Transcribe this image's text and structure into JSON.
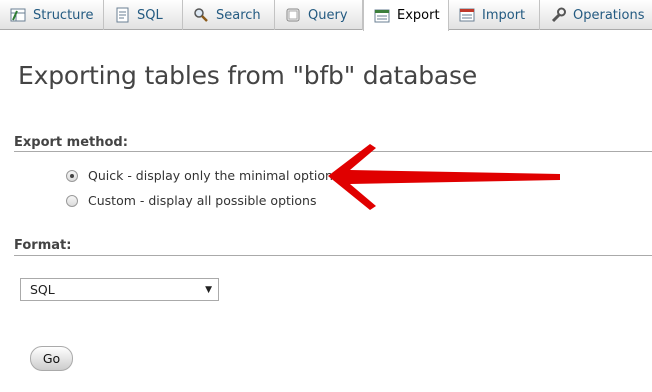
{
  "tabs": [
    {
      "label": "Structure",
      "icon": "structure-icon"
    },
    {
      "label": "SQL",
      "icon": "sql-icon"
    },
    {
      "label": "Search",
      "icon": "search-icon"
    },
    {
      "label": "Query",
      "icon": "query-icon"
    },
    {
      "label": "Export",
      "icon": "export-icon",
      "active": true
    },
    {
      "label": "Import",
      "icon": "import-icon"
    },
    {
      "label": "Operations",
      "icon": "operations-icon"
    }
  ],
  "page": {
    "title": "Exporting tables from \"bfb\" database"
  },
  "export_method": {
    "heading": "Export method:",
    "options": [
      {
        "label": "Quick - display only the minimal options",
        "checked": true
      },
      {
        "label": "Custom - display all possible options",
        "checked": false
      }
    ]
  },
  "format": {
    "heading": "Format:",
    "selected": "SQL"
  },
  "go_button": {
    "label": "Go"
  },
  "colors": {
    "annotation_arrow": "#e00000",
    "tab_text": "#235a81"
  }
}
